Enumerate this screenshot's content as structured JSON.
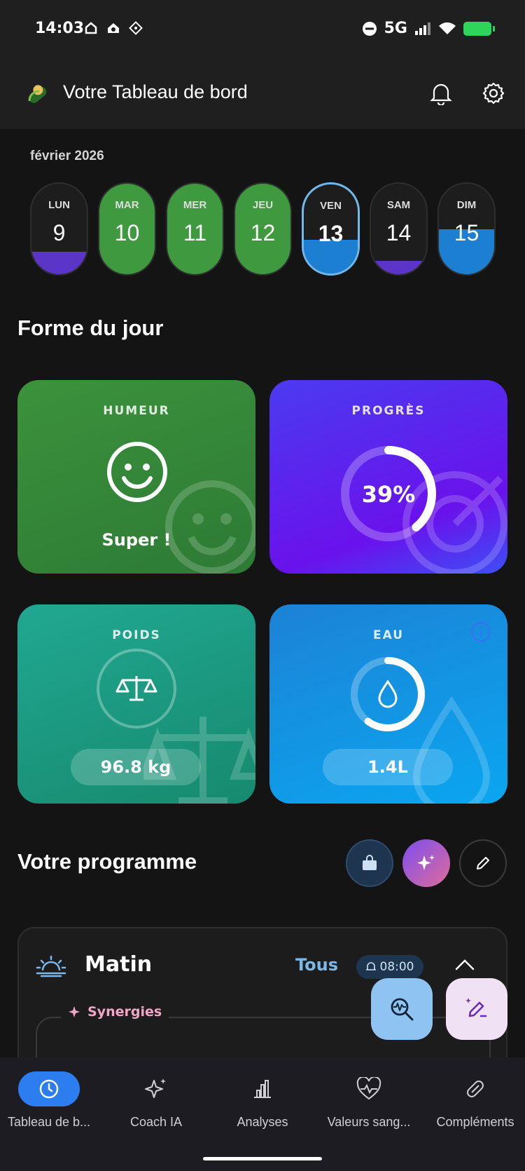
{
  "status_bar": {
    "time": "14:03",
    "network": "5G"
  },
  "app_bar": {
    "title": "Votre Tableau de bord"
  },
  "week": {
    "month": "février 2026",
    "days": [
      {
        "name": "LUN",
        "date": "9",
        "fill_fraction": 0.25,
        "fill_color": "#5b35c8"
      },
      {
        "name": "MAR",
        "date": "10",
        "fill_fraction": 1.0,
        "fill_color": "#3f9a3f"
      },
      {
        "name": "MER",
        "date": "11",
        "fill_fraction": 1.0,
        "fill_color": "#3f9a3f"
      },
      {
        "name": "JEU",
        "date": "12",
        "fill_fraction": 1.0,
        "fill_color": "#3f9a3f"
      },
      {
        "name": "VEN",
        "date": "13",
        "fill_fraction": 0.38,
        "fill_color": "#1d7fd1",
        "today": true
      },
      {
        "name": "SAM",
        "date": "14",
        "fill_fraction": 0.15,
        "fill_color": "#5b35c8"
      },
      {
        "name": "DIM",
        "date": "15",
        "fill_fraction": 0.5,
        "fill_color": "#1d7fd1"
      }
    ]
  },
  "forme": {
    "title": "Forme du jour",
    "humeur": {
      "label": "HUMEUR",
      "value": "Super !"
    },
    "progres": {
      "label": "PROGRÈS",
      "value": "39%",
      "fraction": 0.39
    },
    "poids": {
      "label": "POIDS",
      "value": "96.8 kg"
    },
    "eau": {
      "label": "EAU",
      "value": "1.4L",
      "fraction": 0.6
    }
  },
  "programme": {
    "title": "Votre programme",
    "section": {
      "title": "Matin",
      "filter": "Tous",
      "alarm": "08:00"
    },
    "synergies_label": "Synergies"
  },
  "bottom_nav": [
    {
      "label": "Tableau de b...",
      "icon": "clock-icon",
      "active": true
    },
    {
      "label": "Coach IA",
      "icon": "sparkles-icon"
    },
    {
      "label": "Analyses",
      "icon": "bar-chart-icon"
    },
    {
      "label": "Valeurs sang...",
      "icon": "heart-pulse-icon"
    },
    {
      "label": "Compléments",
      "icon": "pill-icon"
    }
  ],
  "colors": {
    "humeur_card": "#3a8f3a",
    "progres_card": "#5a2bef",
    "poids_card": "#1a9a86",
    "eau_card": "#1a8fe0",
    "accent_blue": "#2c7ef0"
  }
}
